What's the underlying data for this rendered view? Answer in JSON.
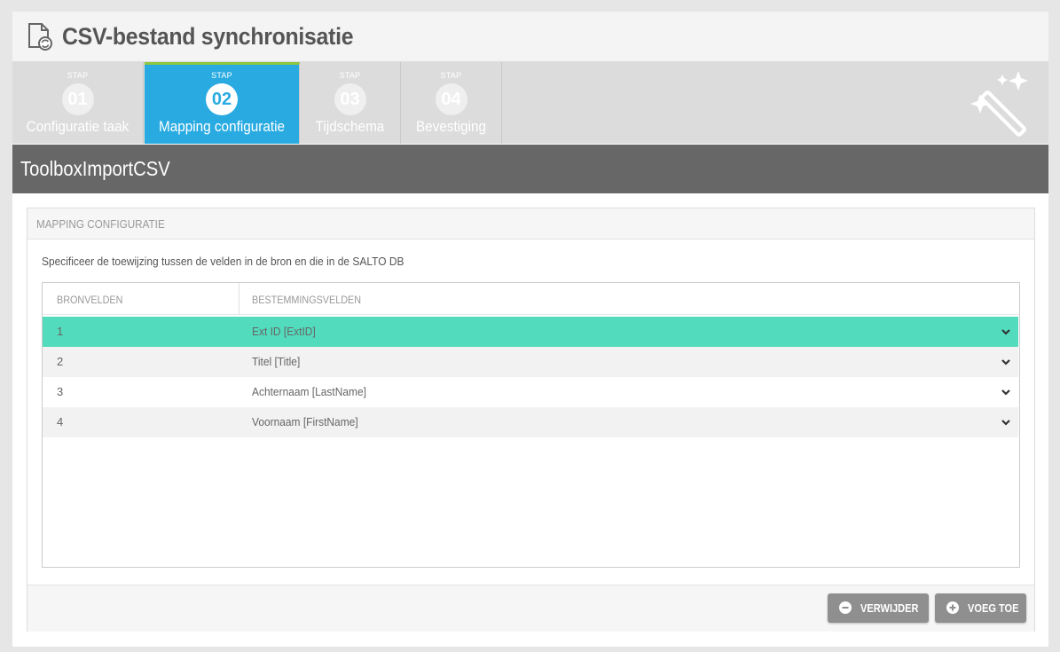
{
  "header": {
    "title": "CSV-bestand synchronisatie",
    "icon": "document-sync-icon"
  },
  "steps": [
    {
      "stap": "STAP",
      "number": "01",
      "label": "Configuratie taak",
      "active": false
    },
    {
      "stap": "STAP",
      "number": "02",
      "label": "Mapping configuratie",
      "active": true
    },
    {
      "stap": "STAP",
      "number": "03",
      "label": "Tijdschema",
      "active": false
    },
    {
      "stap": "STAP",
      "number": "04",
      "label": "Bevestiging",
      "active": false
    }
  ],
  "task_name": "ToolboxImportCSV",
  "panel": {
    "title": "MAPPING CONFIGURATIE",
    "description": "Specificeer de toewijzing tussen de velden in de bron en die in de SALTO DB"
  },
  "table": {
    "columns": [
      "BRONVELDEN",
      "BESTEMMINGSVELDEN"
    ],
    "rows": [
      {
        "source": "1",
        "destination": "Ext ID [ExtID]",
        "selected": true
      },
      {
        "source": "2",
        "destination": "Titel [Title]",
        "selected": false
      },
      {
        "source": "3",
        "destination": "Achternaam [LastName]",
        "selected": false
      },
      {
        "source": "4",
        "destination": "Voornaam [FirstName]",
        "selected": false
      }
    ]
  },
  "buttons": {
    "remove": "VERWIJDER",
    "add": "VOEG TOE"
  },
  "colors": {
    "active_step": "#29abe2",
    "active_step_top": "#8dc63f",
    "selected_row": "#52dcbd",
    "title_bar": "#676767",
    "button": "#8f8f8f"
  }
}
